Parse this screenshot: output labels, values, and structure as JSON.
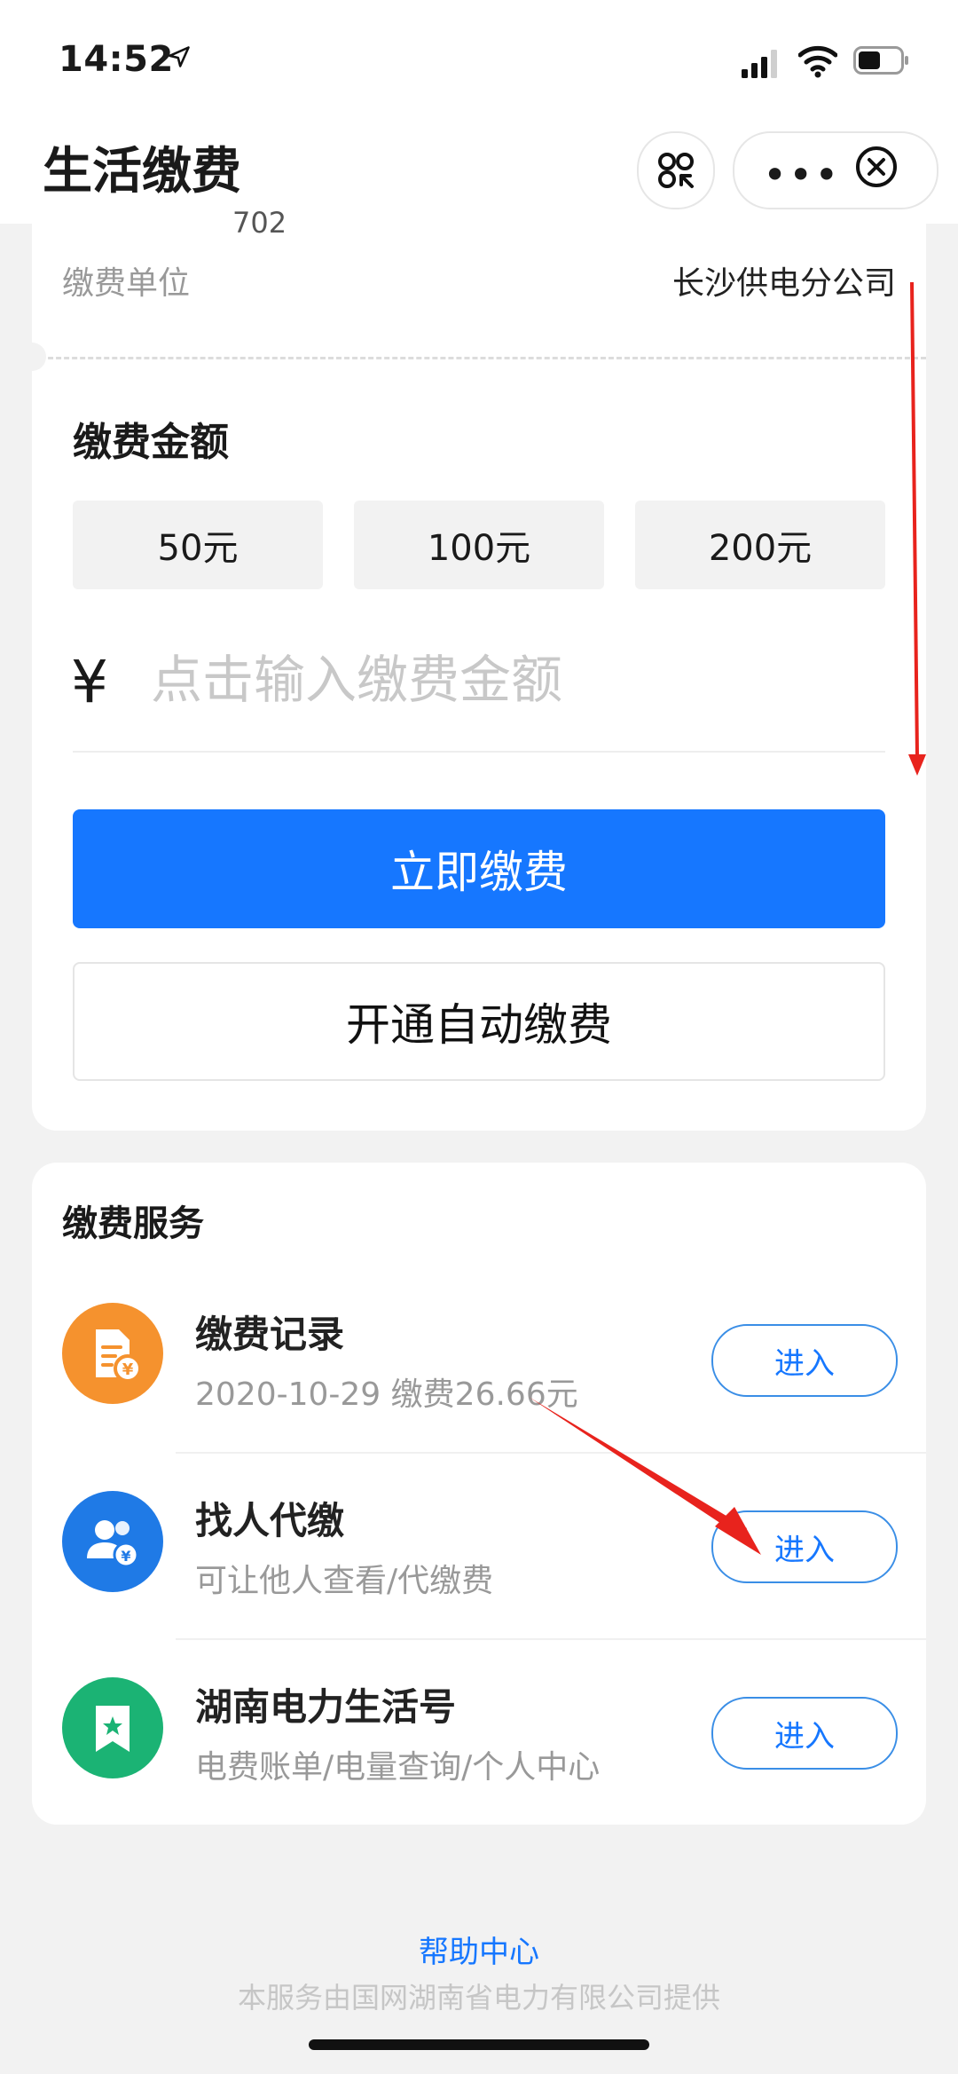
{
  "status_bar": {
    "time": "14:52"
  },
  "nav": {
    "title": "生活缴费"
  },
  "account": {
    "partial_text": "702",
    "unit_label": "缴费单位",
    "unit_value": "长沙供电分公司"
  },
  "amount": {
    "title": "缴费金额",
    "options": [
      "50元",
      "100元",
      "200元"
    ],
    "currency_symbol": "¥",
    "input_placeholder": "点击输入缴费金额",
    "pay_button": "立即缴费",
    "auto_pay_button": "开通自动缴费"
  },
  "services": {
    "title": "缴费服务",
    "items": [
      {
        "name": "缴费记录",
        "subtitle": "2020-10-29 缴费26.66元",
        "action": "进入",
        "icon": "receipt-yuan-icon",
        "color": "#f5922e"
      },
      {
        "name": "找人代缴",
        "subtitle": "可让他人查看/代缴费",
        "action": "进入",
        "icon": "users-yuan-icon",
        "color": "#1f7ae6"
      },
      {
        "name": "湖南电力生活号",
        "subtitle": "电费账单/电量查询/个人中心",
        "action": "进入",
        "icon": "bookmark-star-icon",
        "color": "#1bb374"
      }
    ]
  },
  "footer": {
    "help_link": "帮助中心",
    "provider": "本服务由国网湖南省电力有限公司提供"
  },
  "colors": {
    "primary": "#1677ff",
    "annotation": "#e8231d"
  }
}
